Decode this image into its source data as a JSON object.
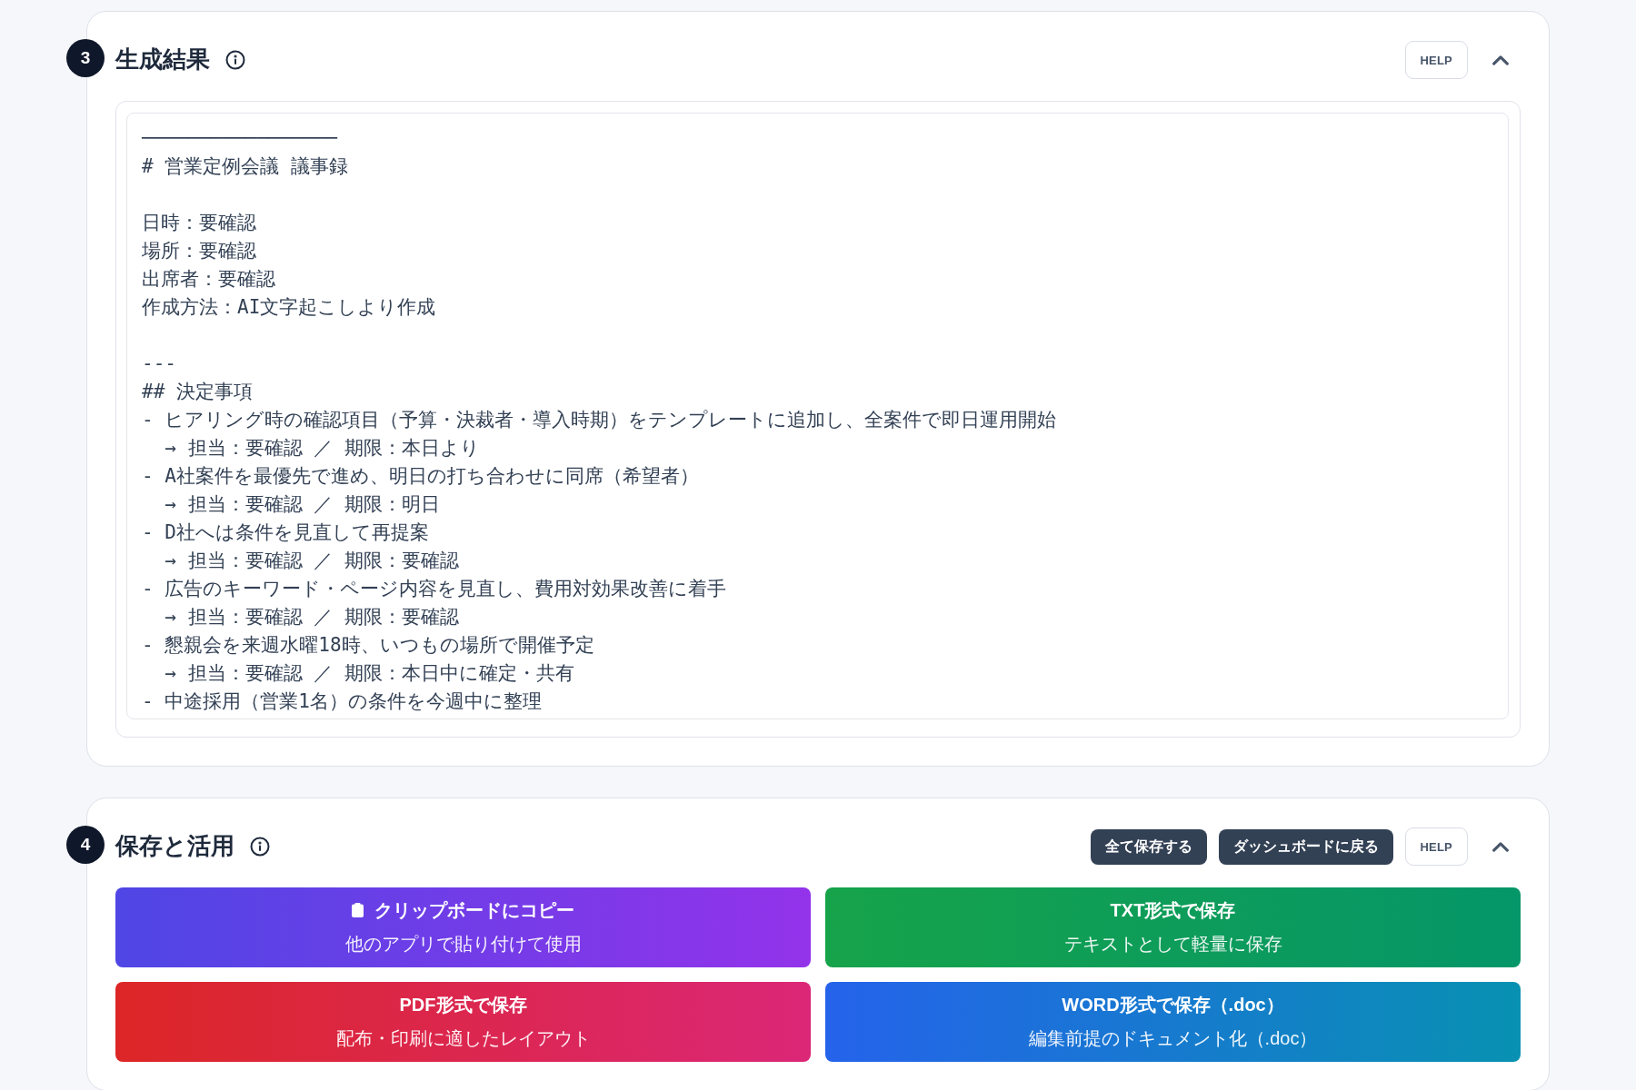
{
  "sections": [
    {
      "number": "3",
      "title": "生成結果",
      "expanded": true,
      "help_button": "HELP",
      "result_text": {
        "paragraphs": [
          [
            "─────────────────",
            "# 営業定例会議 議事録"
          ],
          [
            "日時：要確認",
            "場所：要確認",
            "出席者：要確認",
            "作成方法：AI文字起こしより作成"
          ],
          [
            "---",
            "## 決定事項",
            "- ヒアリング時の確認項目（予算・決裁者・導入時期）をテンプレートに追加し、全案件で即日運用開始",
            "  → 担当：要確認 ／ 期限：本日より",
            "- A社案件を最優先で進め、明日の打ち合わせに同席（希望者）",
            "  → 担当：要確認 ／ 期限：明日",
            "- D社へは条件を見直して再提案",
            "  → 担当：要確認 ／ 期限：要確認",
            "- 広告のキーワード・ページ内容を見直し、費用対効果改善に着手",
            "  → 担当：要確認 ／ 期限：要確認",
            "- 懇親会を来週水曜18時、いつもの場所で開催予定",
            "  → 担当：要確認 ／ 期限：本日中に確定・共有",
            "- 中途採用（営業1名）の条件を今週中に整理"
          ]
        ]
      }
    },
    {
      "number": "4",
      "title": "保存と活用",
      "expanded": true,
      "header_buttons": [
        "全て保存する",
        "ダッシュボードに戻る"
      ],
      "help_button": "HELP",
      "save_options": [
        {
          "kind": "clipboard",
          "label": "クリップボードにコピー",
          "description": "他のアプリで貼り付けて使用"
        },
        {
          "kind": "txt",
          "label": "TXT形式で保存",
          "description": "テキストとして軽量に保存"
        },
        {
          "kind": "pdf",
          "label": "PDF形式で保存",
          "description": "配布・印刷に適したレイアウト"
        },
        {
          "kind": "word",
          "label": "WORD形式で保存（.doc）",
          "description": "編集前提のドキュメント化（.doc）"
        }
      ]
    }
  ]
}
